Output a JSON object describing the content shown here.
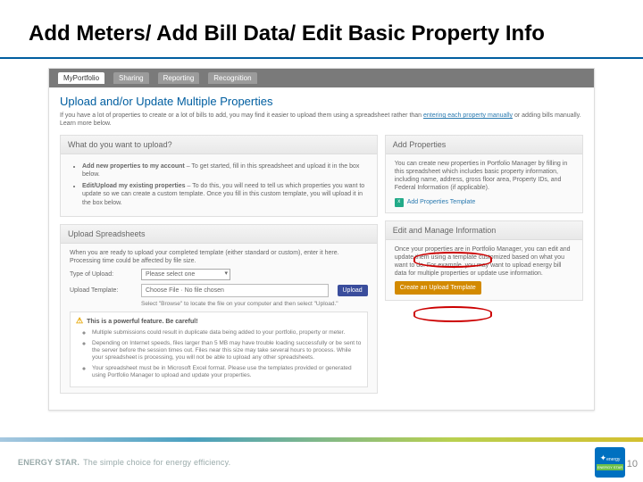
{
  "title": "Add Meters/ Add Bill Data/ Edit Basic Property Info",
  "tabs": {
    "portfolio": "MyPortfolio",
    "sharing": "Sharing",
    "reporting": "Reporting",
    "recognition": "Recognition"
  },
  "header": {
    "heading": "Upload and/or Update Multiple Properties",
    "intro1": "If you have a lot of properties to create or a lot of bills to add, you may find it easier to upload them using a spreadsheet rather than ",
    "introLink1": "entering each property manually",
    "intro2": " or adding bills manually. Learn more below."
  },
  "left": {
    "panel1head": "What do you want to upload?",
    "bullet1a": "Add new properties to my account",
    "bullet1b": " – To get started, fill in ",
    "bullet1link": "this spreadsheet",
    "bullet1c": " and upload it in the box below.",
    "bullet2a": "Edit/Upload my existing properties",
    "bullet2b": " – To do this, you will need to tell us which properties you want to update so we can ",
    "bullet2link": "create a custom template.",
    "bullet2c": " Once you fill in this custom template, you will upload it in the box below.",
    "panel2head": "Upload Spreadsheets",
    "panel2intro": "When you are ready to upload your completed template (either standard or custom), enter it here. Processing time could be affected by file size.",
    "labelType": "Type of Upload:",
    "selectPlaceholder": "Please select one",
    "labelTemplate": "Upload Template:",
    "fileBtn": "Choose File",
    "fileStatus": "No file chosen",
    "uploadBtn": "Upload",
    "help": "Select \"Browse\" to locate the file on your computer and then select \"Upload.\"",
    "warnHead": "This is a powerful feature. Be careful!",
    "warn1": "Multiple submissions could result in duplicate data being added to your portfolio, property or meter.",
    "warn2": "Depending on Internet speeds, files larger than 5 MB may have trouble loading successfully or be sent to the server before the session times out. Files near this size may take several hours to process. While your spreadsheet is processing, you will not be able to upload any other spreadsheets.",
    "warn3": "Your spreadsheet must be in Microsoft Excel format. Please use the templates provided or generated using Portfolio Manager to upload and update your properties."
  },
  "right": {
    "panel1head": "Add Properties",
    "panel1intro1": "You can create new properties in Portfolio Manager by filling in ",
    "panel1link": "this spreadsheet",
    "panel1intro2": " which includes basic property information, including name, address, gross floor area, Property IDs, and Federal Information (if applicable).",
    "tplLink": "Add Properties Template",
    "panel2head": "Edit and Manage Information",
    "panel2intro": "Once your properties are in Portfolio Manager, you can edit and update them using a template customized based on what you want to do. For example, you may want to upload energy bill data for multiple properties or update use information.",
    "createBtn": "Create an Upload Template"
  },
  "footer": {
    "brand": "ENERGY STAR.",
    "tag": "The simple choice for energy efficiency.",
    "brandLabel": "energy",
    "brandBand": "ENERGY STAR"
  },
  "pageNumber": "10"
}
